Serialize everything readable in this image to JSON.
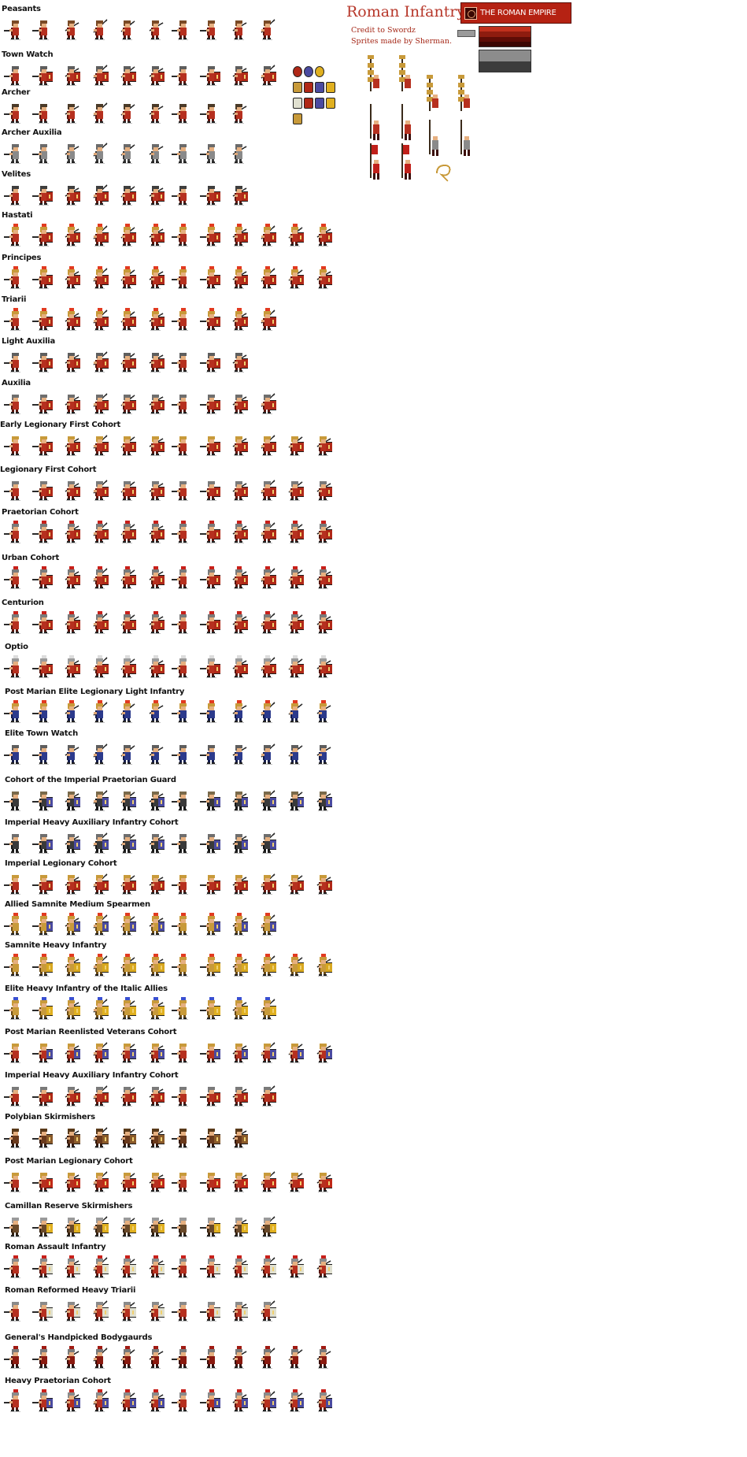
{
  "sheet": {
    "title": "Roman Infantry",
    "credit_1": "Credit to Swordz",
    "credit_2": "Sprites made by Sherman.",
    "faction_banner": "THE ROMAN EMPIRE",
    "faction_icon": "laurel-emblem-icon"
  },
  "colors": {
    "title": "#b7372a",
    "banner": "#b52213",
    "swatch_reds": [
      "#c0301c",
      "#8e1c0f",
      "#5e0c06",
      "#3c0603"
    ],
    "swatch_grays": [
      "#8c8c8c",
      "#3c3c3c"
    ],
    "swatch_small": "#9a9a9a"
  },
  "rows": [
    {
      "label": "Peasants",
      "count": 10,
      "palette": {
        "body": "#b6301f",
        "dark": "#5a140c",
        "helm": "#7a4a25",
        "shield": null,
        "plume": null
      }
    },
    {
      "label": "Town Watch",
      "count": 10,
      "palette": {
        "body": "#b6301f",
        "dark": "#5a140c",
        "helm": "#5e5e5e",
        "shield": "#b02817",
        "plume": null
      }
    },
    {
      "label": "Archer",
      "count": 9,
      "palette": {
        "body": "#b6301f",
        "dark": "#5a140c",
        "helm": "#4a3a28",
        "shield": null,
        "plume": null
      }
    },
    {
      "label": "Archer Auxilia",
      "count": 9,
      "palette": {
        "body": "#8a8a8a",
        "dark": "#3a3a3a",
        "helm": "#6a6a6a",
        "shield": null,
        "plume": null
      }
    },
    {
      "label": "Velites",
      "count": 9,
      "palette": {
        "body": "#b6301f",
        "dark": "#5a140c",
        "helm": "#3e3e3e",
        "shield": "#b02817",
        "plume": null
      }
    },
    {
      "label": "Hastati",
      "count": 12,
      "palette": {
        "body": "#b6301f",
        "dark": "#5a140c",
        "helm": "#c89a3a",
        "shield": "#b02817",
        "plume": "#e23a20"
      }
    },
    {
      "label": "Principes",
      "count": 12,
      "palette": {
        "body": "#b6301f",
        "dark": "#5a140c",
        "helm": "#c89a3a",
        "shield": "#b02817",
        "plume": "#e23a20"
      }
    },
    {
      "label": "Triarii",
      "count": 10,
      "palette": {
        "body": "#b6301f",
        "dark": "#5a140c",
        "helm": "#c89a3a",
        "shield": "#b02817",
        "plume": "#e23a20"
      }
    },
    {
      "label": "Light Auxilia",
      "count": 9,
      "palette": {
        "body": "#b6301f",
        "dark": "#5a140c",
        "helm": "#5e5e5e",
        "shield": "#b02817",
        "plume": null
      }
    },
    {
      "label": "Auxilia",
      "count": 10,
      "palette": {
        "body": "#b6301f",
        "dark": "#5a140c",
        "helm": "#6e6e6e",
        "shield": "#b02817",
        "plume": null
      }
    },
    {
      "label": "Early Legionary First Cohort",
      "count": 12,
      "palette": {
        "body": "#b6301f",
        "dark": "#5a140c",
        "helm": "#c89a3a",
        "shield": "#b02817",
        "plume": null
      }
    },
    {
      "label": "Legionary First Cohort",
      "count": 12,
      "palette": {
        "body": "#b6301f",
        "dark": "#5a140c",
        "helm": "#7a7a7a",
        "shield": "#b02817",
        "plume": null
      }
    },
    {
      "label": "Praetorian Cohort",
      "count": 12,
      "palette": {
        "body": "#b6301f",
        "dark": "#5a140c",
        "helm": "#7a7a7a",
        "shield": "#b02817",
        "plume": "#c8201a"
      }
    },
    {
      "label": "Urban Cohort",
      "count": 12,
      "palette": {
        "body": "#b6301f",
        "dark": "#5a140c",
        "helm": "#7a7a7a",
        "shield": "#b02817",
        "plume": "#c8201a"
      }
    },
    {
      "label": "Centurion",
      "count": 12,
      "palette": {
        "body": "#b6301f",
        "dark": "#5a140c",
        "helm": "#7a7a7a",
        "shield": "#b02817",
        "plume": "#c8201a"
      }
    },
    {
      "label": "Optio",
      "count": 12,
      "palette": {
        "body": "#b6301f",
        "dark": "#5a140c",
        "helm": "#9a9a9a",
        "shield": "#b02817",
        "plume": "#dcdcdc"
      }
    },
    {
      "label": "Post Marian Elite Legionary Light Infantry",
      "count": 12,
      "palette": {
        "body": "#2c3a8c",
        "dark": "#141c4a",
        "helm": "#c89a3a",
        "shield": null,
        "plume": "#e23a20"
      }
    },
    {
      "label": "Elite Town Watch",
      "count": 12,
      "palette": {
        "body": "#2c3a8c",
        "dark": "#141c4a",
        "helm": "#5e5e5e",
        "shield": null,
        "plume": null
      }
    },
    {
      "label": "Cohort of the Imperial Praetorian Guard",
      "count": 12,
      "palette": {
        "body": "#3a3a3a",
        "dark": "#161616",
        "helm": "#7a6a4a",
        "shield": "#4a4aa0",
        "plume": null
      }
    },
    {
      "label": "Imperial Heavy Auxiliary Infantry Cohort",
      "count": 10,
      "palette": {
        "body": "#3a3a3a",
        "dark": "#161616",
        "helm": "#6e6e6e",
        "shield": "#4a4aa0",
        "plume": null
      }
    },
    {
      "label": "Imperial Legionary Cohort",
      "count": 12,
      "palette": {
        "body": "#b6301f",
        "dark": "#5a140c",
        "helm": "#c89a3a",
        "shield": "#b02817",
        "plume": null
      }
    },
    {
      "label": "Allied Samnite Medium Spearmen",
      "count": 10,
      "palette": {
        "body": "#c89a3a",
        "dark": "#6a4a14",
        "helm": "#c89a3a",
        "shield": "#4a4aa0",
        "plume": "#e23a20"
      }
    },
    {
      "label": "Samnite Heavy Infantry",
      "count": 12,
      "palette": {
        "body": "#c89a3a",
        "dark": "#6a4a14",
        "helm": "#c89a3a",
        "shield": "#d8a820",
        "plume": "#e23a20"
      }
    },
    {
      "label": "Elite Heavy Infantry of the Italic Allies",
      "count": 10,
      "palette": {
        "body": "#c89a3a",
        "dark": "#6a4a14",
        "helm": "#c89a3a",
        "shield": "#e0b020",
        "plume": "#3a50d0"
      }
    },
    {
      "label": "Post Marian Reenlisted Veterans Cohort",
      "count": 12,
      "palette": {
        "body": "#b6301f",
        "dark": "#5a140c",
        "helm": "#c89a3a",
        "shield": "#4a4aa0",
        "plume": null
      }
    },
    {
      "label": "Imperial Heavy Auxiliary Infantry Cohort",
      "count": 10,
      "palette": {
        "body": "#b6301f",
        "dark": "#5a140c",
        "helm": "#7a7a7a",
        "shield": "#b02817",
        "plume": null
      }
    },
    {
      "label": "Polybian Skirmishers",
      "count": 9,
      "palette": {
        "body": "#6a3a1c",
        "dark": "#34180a",
        "helm": "#5a3a1a",
        "shield": "#8a5a2a",
        "plume": null
      }
    },
    {
      "label": "Post Marian Legionary Cohort",
      "count": 12,
      "palette": {
        "body": "#b6301f",
        "dark": "#5a140c",
        "helm": "#c89a3a",
        "shield": "#c02817",
        "plume": null
      }
    },
    {
      "label": "Camillan Reserve Skirmishers",
      "count": 10,
      "palette": {
        "body": "#6a4a2a",
        "dark": "#34200e",
        "helm": "#9a9a9a",
        "shield": "#e0b020",
        "plume": null
      }
    },
    {
      "label": "Roman Assault Infantry",
      "count": 12,
      "palette": {
        "body": "#b6301f",
        "dark": "#5a140c",
        "helm": "#8a8a8a",
        "shield": "#e0e0d0",
        "plume": "#c8201a"
      }
    },
    {
      "label": "Roman Reformed Heavy Triarii",
      "count": 10,
      "palette": {
        "body": "#b6301f",
        "dark": "#5a140c",
        "helm": "#8a8a8a",
        "shield": "#e0e0d0",
        "plume": null
      }
    },
    {
      "label": "General's Handpicked Bodygaurds",
      "count": 12,
      "palette": {
        "body": "#8a1a10",
        "dark": "#3a0a06",
        "helm": "#7a7a7a",
        "shield": null,
        "plume": "#a01a12"
      }
    },
    {
      "label": "Heavy Praetorian Cohort",
      "count": 12,
      "palette": {
        "body": "#b6301f",
        "dark": "#5a140c",
        "helm": "#8a8a8a",
        "shield": "#4a4aa0",
        "plume": "#c8201a"
      }
    }
  ],
  "extras": {
    "shield_icons": [
      "#b02817",
      "#4a4aa0",
      "#e0b020",
      "#c89a3a",
      "#b02817",
      "#4a4aa0",
      "#e0b020",
      "#e0e0d0"
    ],
    "standards": [
      "eagle-standard",
      "eagle-standard",
      "signum-standard",
      "signum-standard",
      "standard-bearer",
      "standard-bearer",
      "cornicen",
      "cornicen",
      "vexillum-bearer",
      "vexillum-bearer",
      "cornu-horn"
    ]
  }
}
